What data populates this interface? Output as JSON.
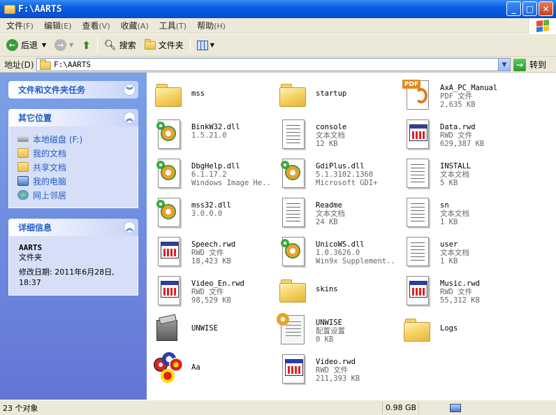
{
  "window": {
    "title": "F:\\AARTS"
  },
  "menu": [
    {
      "label": "文件",
      "key": "(F)"
    },
    {
      "label": "编辑",
      "key": "(E)"
    },
    {
      "label": "查看",
      "key": "(V)"
    },
    {
      "label": "收藏",
      "key": "(A)"
    },
    {
      "label": "工具",
      "key": "(T)"
    },
    {
      "label": "帮助",
      "key": "(H)"
    }
  ],
  "toolbar": {
    "back": "后退",
    "search": "搜索",
    "folders": "文件夹"
  },
  "address": {
    "label": "地址(D)",
    "value": "F:\\AARTS",
    "go": "转到"
  },
  "tasks": {
    "file_tasks": {
      "title": "文件和文件夹任务"
    },
    "other_places": {
      "title": "其它位置",
      "links": [
        "本地磁盘 (F:)",
        "我的文档",
        "共享文档",
        "我的电脑",
        "网上邻居"
      ]
    },
    "details": {
      "title": "详细信息",
      "name": "AARTS",
      "type": "文件夹",
      "modified": "修改日期: 2011年6月28日, 18:37"
    }
  },
  "files": [
    {
      "name": "mss",
      "line2": "",
      "line3": "",
      "icon": "folder"
    },
    {
      "name": "startup",
      "line2": "",
      "line3": "",
      "icon": "folder"
    },
    {
      "name": "AxA_PC_Manual",
      "line2": "PDF 文件",
      "line3": "2,635 KB",
      "icon": "pdf"
    },
    {
      "name": "BinkW32.dll",
      "line2": "1.5.21.0",
      "line3": "",
      "icon": "dll"
    },
    {
      "name": "console",
      "line2": "文本文档",
      "line3": "12 KB",
      "icon": "doc"
    },
    {
      "name": "Data.rwd",
      "line2": "RWD 文件",
      "line3": "629,387 KB",
      "icon": "rwd"
    },
    {
      "name": "DbgHelp.dll",
      "line2": "6.1.17.2",
      "line3": "Windows Image He...",
      "icon": "dll"
    },
    {
      "name": "GdiPlus.dll",
      "line2": "5.1.3102.1360",
      "line3": "Microsoft GDI+",
      "icon": "dll"
    },
    {
      "name": "INSTALL",
      "line2": "文本文档",
      "line3": "5 KB",
      "icon": "doc"
    },
    {
      "name": "mss32.dll",
      "line2": "3.0.0.0",
      "line3": "",
      "icon": "dll"
    },
    {
      "name": "Readme",
      "line2": "文本文档",
      "line3": "24 KB",
      "icon": "doc"
    },
    {
      "name": "sn",
      "line2": "文本文档",
      "line3": "1 KB",
      "icon": "doc"
    },
    {
      "name": "Speech.rwd",
      "line2": "RWD 文件",
      "line3": "18,423 KB",
      "icon": "rwd"
    },
    {
      "name": "UnicoWS.dll",
      "line2": "1.0.3626.0",
      "line3": "Win9x Supplement...",
      "icon": "dll"
    },
    {
      "name": "user",
      "line2": "文本文档",
      "line3": "1 KB",
      "icon": "doc"
    },
    {
      "name": "Video_En.rwd",
      "line2": "RWD 文件",
      "line3": "98,529 KB",
      "icon": "rwd"
    },
    {
      "name": "skins",
      "line2": "",
      "line3": "",
      "icon": "folder"
    },
    {
      "name": "Music.rwd",
      "line2": "RWD 文件",
      "line3": "55,312 KB",
      "icon": "rwd"
    },
    {
      "name": "UNWISE",
      "line2": "",
      "line3": "",
      "icon": "install"
    },
    {
      "name": "UNWISE",
      "line2": "配置设置",
      "line3": "0 KB",
      "icon": "cfg"
    },
    {
      "name": "Logs",
      "line2": "",
      "line3": "",
      "icon": "folder"
    },
    {
      "name": "Aa",
      "line2": "",
      "line3": "",
      "icon": "aa"
    },
    {
      "name": "Video.rwd",
      "line2": "RWD 文件",
      "line3": "211,393 KB",
      "icon": "rwd"
    }
  ],
  "status": {
    "count": "23 个对象",
    "size": "0.98 GB"
  },
  "colors": {
    "title": "#0754d8",
    "pane": "#6f8de0",
    "link": "#215dc6"
  }
}
